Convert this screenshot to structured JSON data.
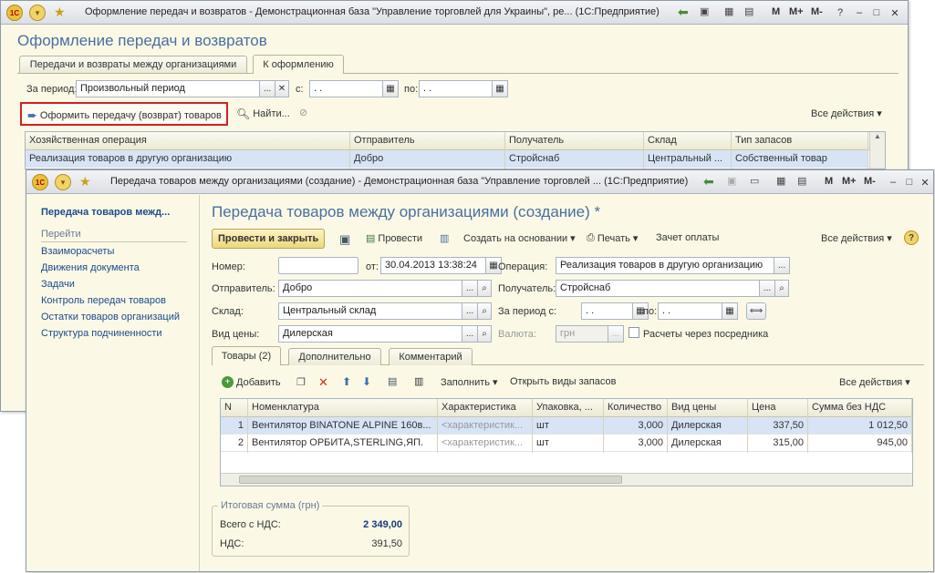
{
  "back_window": {
    "title": "Оформление передач и возвратов - Демонстрационная база \"Управление торговлей для Украины\", ре... (1С:Предприятие)",
    "heading": "Оформление передач и возвратов",
    "tabs": [
      "Передачи и возвраты между организациями",
      "К оформлению"
    ],
    "period_label": "За период:",
    "period_value": "Произвольный период",
    "from_label": "с:",
    "from_value": ". .",
    "to_label": "по:",
    "to_value": ". .",
    "create_btn": "Оформить передачу (возврат) товаров",
    "find_btn": "Найти...",
    "all_actions": "Все действия",
    "columns": [
      "Хозяйственная операция",
      "Отправитель",
      "Получатель",
      "Склад",
      "Тип запасов"
    ],
    "row": [
      "Реализация товаров в другую организацию",
      "Добро",
      "Стройснаб",
      "Центральный ...",
      "Собственный товар"
    ],
    "m_buttons": [
      "M",
      "M+",
      "M-"
    ]
  },
  "front_window": {
    "title": "Передача товаров между организациями (создание) - Демонстрационная база \"Управление торговлей ... (1С:Предприятие)",
    "nav_title": "Передача товаров межд...",
    "nav_goto": "Перейти",
    "nav_items": [
      "Взаиморасчеты",
      "Движения документа",
      "Задачи",
      "Контроль передач товаров",
      "Остатки товаров организаций",
      "Структура подчиненности"
    ],
    "heading": "Передача товаров между организациями (создание) *",
    "toolbar": {
      "post_close": "Провести и закрыть",
      "post": "Провести",
      "create_based": "Создать на основании",
      "print": "Печать",
      "payment": "Зачет оплаты",
      "all_actions": "Все действия"
    },
    "form": {
      "number_label": "Номер:",
      "number_value": "",
      "date_label": "от:",
      "date_value": "30.04.2013 13:38:24",
      "operation_label": "Операция:",
      "operation_value": "Реализация товаров в другую организацию",
      "sender_label": "Отправитель:",
      "sender_value": "Добро",
      "receiver_label": "Получатель:",
      "receiver_value": "Стройснаб",
      "warehouse_label": "Склад:",
      "warehouse_value": "Центральный склад",
      "period_from_label": "За период с:",
      "period_from_value": ". .",
      "period_to_label": "по:",
      "period_to_value": ". .",
      "price_type_label": "Вид цены:",
      "price_type_value": "Дилерская",
      "currency_label": "Валюта:",
      "currency_value": "грн",
      "intermediary_label": "Расчеты через посредника"
    },
    "tabs": [
      "Товары (2)",
      "Дополнительно",
      "Комментарий"
    ],
    "goods_toolbar": {
      "add": "Добавить",
      "fill": "Заполнить",
      "open_stock_types": "Открыть виды запасов",
      "all_actions": "Все действия"
    },
    "columns": [
      "N",
      "Номенклатура",
      "Характеристика",
      "Упаковка, ...",
      "Количество",
      "Вид цены",
      "Цена",
      "Сумма без НДС"
    ],
    "rows": [
      [
        "1",
        "Вентилятор BINATONE ALPINE 160в...",
        "<характеристик...",
        "шт",
        "3,000",
        "Дилерская",
        "337,50",
        "1 012,50"
      ],
      [
        "2",
        "Вентилятор ОРБИТА,STERLING,ЯП.",
        "<характеристик...",
        "шт",
        "3,000",
        "Дилерская",
        "315,00",
        "945,00"
      ]
    ],
    "totals": {
      "group_label": "Итоговая сумма (грн)",
      "total_label": "Всего с НДС:",
      "total_value": "2 349,00",
      "vat_label": "НДС:",
      "vat_value": "391,50"
    },
    "m_buttons": [
      "M",
      "M+",
      "M-"
    ]
  }
}
